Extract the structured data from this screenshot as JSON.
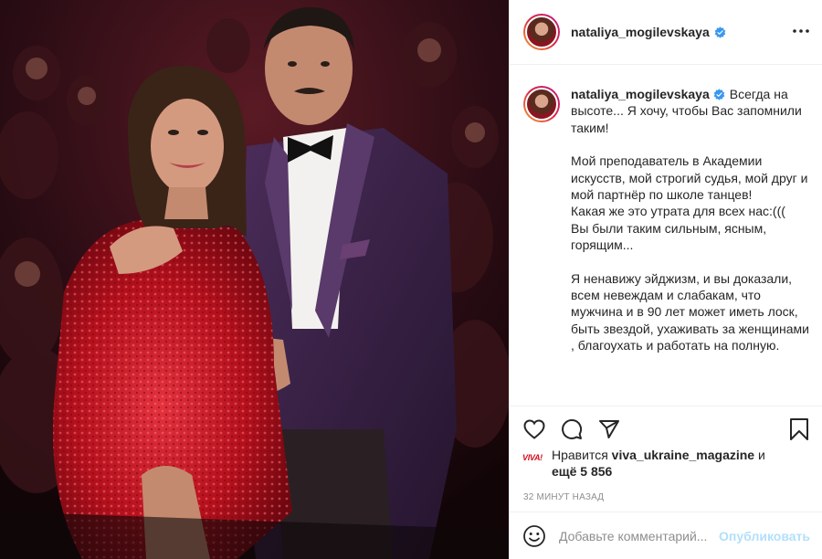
{
  "post": {
    "username": "nataliya_mogilevskaya",
    "verified": true,
    "caption_lines": [
      "Всегда на высоте... Я хочу, чтобы Вас запомнили таким!",
      "",
      "Мой преподаватель в Академии искусств, мой строгий судья, мой друг и мой партнёр по школе танцев!",
      "Какая же это утрата для всех нас:(((",
      "Вы были таким сильным, ясным, горящим...",
      "",
      "Я ненавижу эйджизм, и вы доказали, всем невеждам и слабакам, что мужчина и в 90 лет может иметь лоск, быть звездой, ухаживать за женщинами , благоухать и работать на полную."
    ],
    "likes": {
      "prefix": "Нравится",
      "liker": "viva_ukraine_magazine",
      "conjunction": "и",
      "others": "ещё 5 856",
      "liker_avatar_text": "VIVA!"
    },
    "timestamp": "32 минут назад",
    "comment_box": {
      "placeholder": "Добавьте комментарий...",
      "publish_label": "Опубликовать"
    }
  },
  "icons": {
    "header": [
      "verified-badge-icon",
      "more-options-icon"
    ],
    "actions": [
      "heart-icon",
      "comment-icon",
      "share-icon",
      "bookmark-icon"
    ],
    "composer": [
      "emoji-icon"
    ]
  },
  "colors": {
    "verified_blue": "#3897f0",
    "publish_disabled": "#b2dffc",
    "text": "#262626",
    "muted": "#8e8e8e",
    "dress_red": "#b3101c",
    "suit_purple": "#3b2347"
  }
}
